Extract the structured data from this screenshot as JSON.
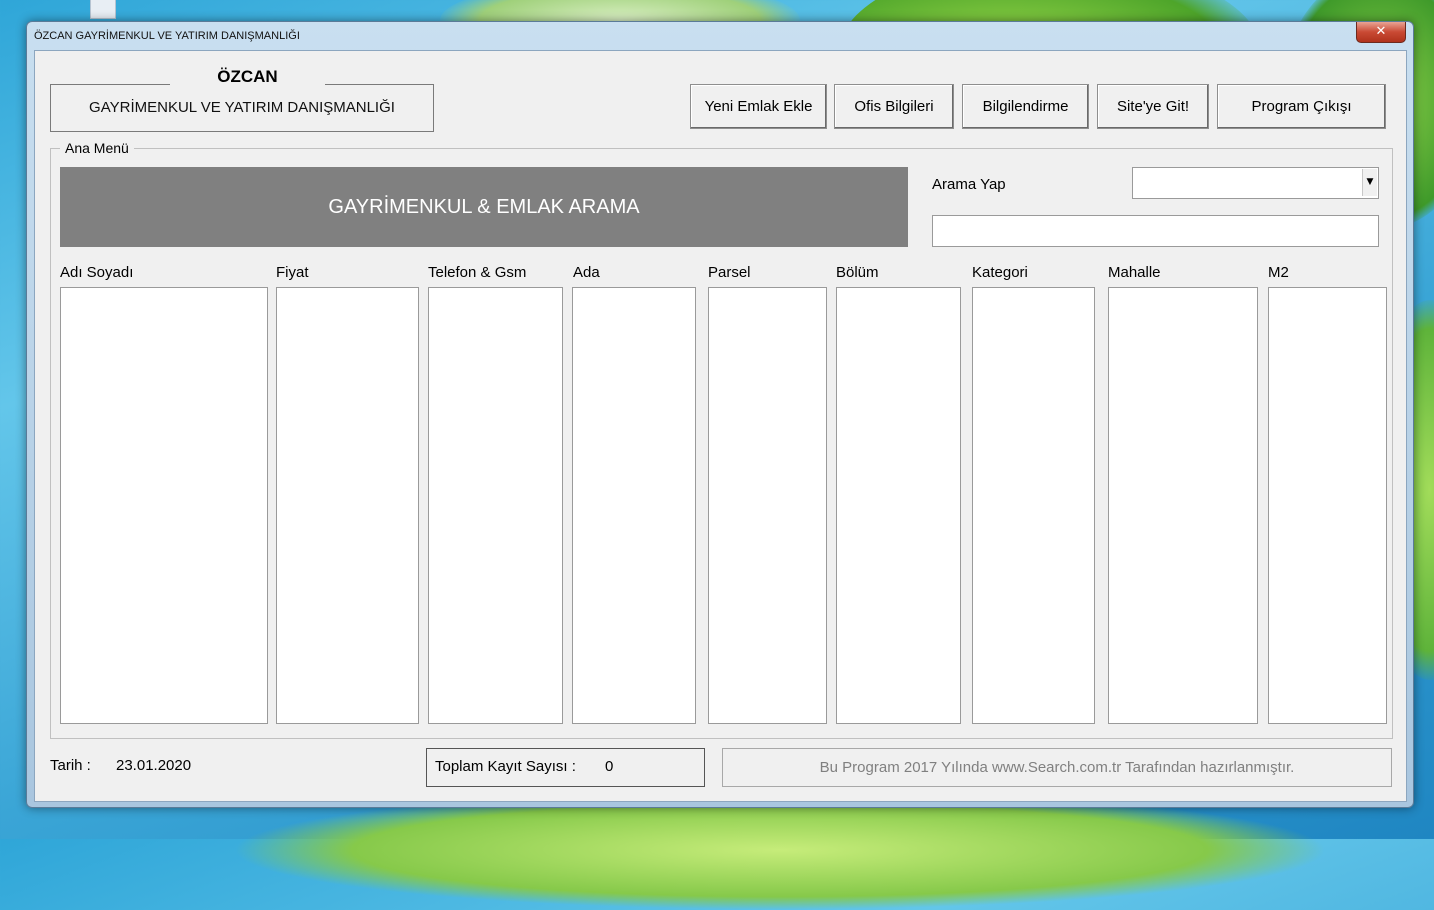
{
  "window": {
    "title": "ÖZCAN GAYRİMENKUL VE YATIRIM DANIŞMANLIĞI",
    "close_glyph": "✕"
  },
  "logo": {
    "name": "ÖZCAN",
    "subtitle": "GAYRİMENKUL VE YATIRIM DANIŞMANLIĞI"
  },
  "toolbar": {
    "new_listing": "Yeni Emlak Ekle",
    "office_info": "Ofis Bilgileri",
    "info": "Bilgilendirme",
    "go_site": "Site'ye Git!",
    "exit": "Program Çıkışı"
  },
  "main_menu": {
    "label": "Ana Menü",
    "banner": "GAYRİMENKUL & EMLAK ARAMA",
    "search_label": "Arama Yap",
    "search_type_value": "",
    "search_text_value": "",
    "columns": [
      "Adı Soyadı",
      "Fiyat",
      "Telefon & Gsm",
      "Ada",
      "Parsel",
      "Bölüm",
      "Kategori",
      "Mahalle",
      "M2"
    ]
  },
  "status": {
    "date_label": "Tarih :",
    "date_value": "23.01.2020",
    "count_label": "Toplam Kayıt Sayısı :",
    "count_value": "0",
    "footer": "Bu Program 2017 Yılında www.Search.com.tr Tarafından hazırlanmıştır."
  },
  "icons": {
    "dropdown": "chevron-down-icon",
    "close": "close-icon"
  },
  "colors": {
    "banner_bg": "#808080",
    "client_bg": "#f0f0f0",
    "close_button": "#c94a34"
  }
}
